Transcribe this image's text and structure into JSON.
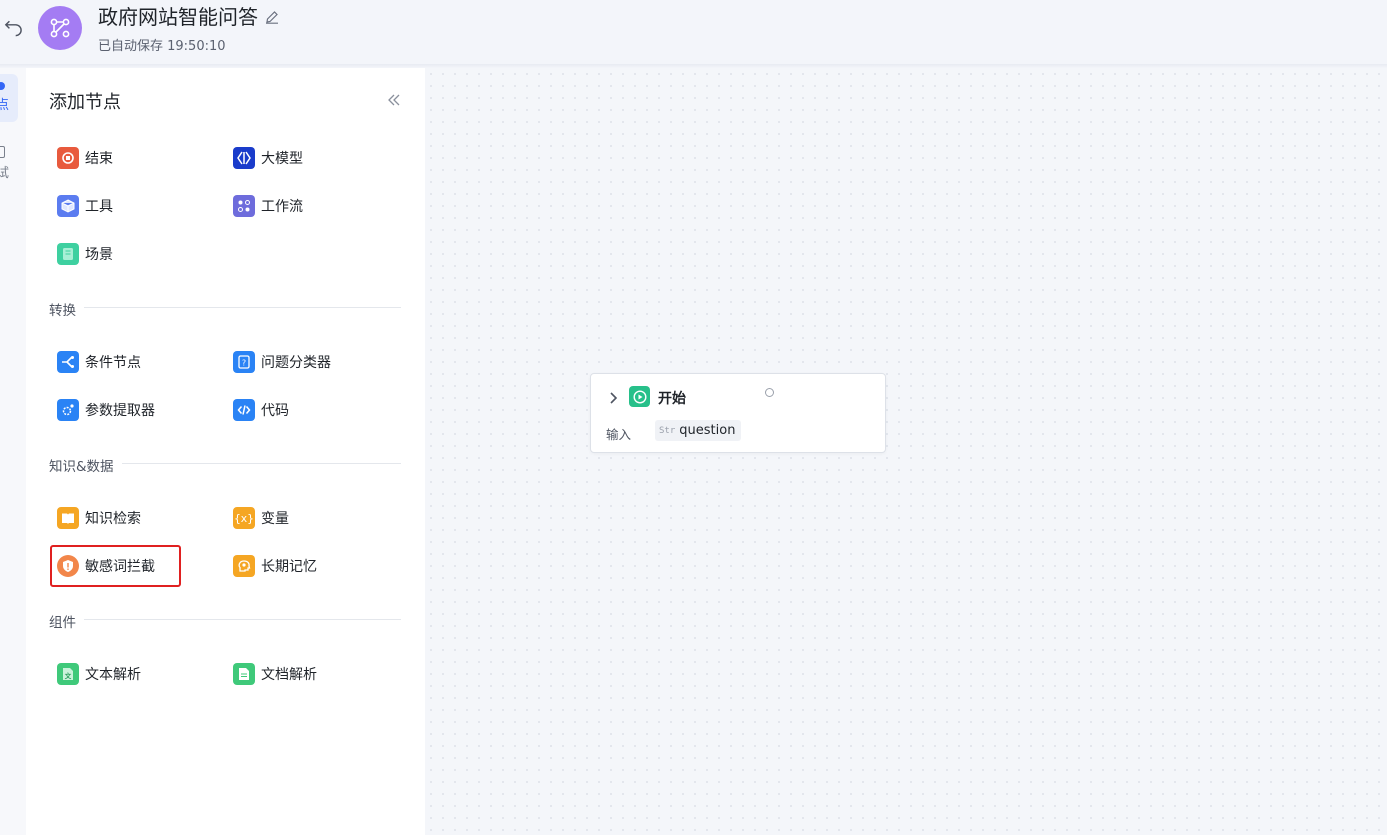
{
  "header": {
    "title": "政府网站智能问答",
    "save_status": "已自动保存 19:50:10",
    "icons": {
      "back": "undo-icon",
      "avatar": "workflow-icon",
      "edit": "pencil-icon"
    }
  },
  "rail": {
    "items": [
      {
        "label": "点",
        "active": true
      },
      {
        "label": "试",
        "active": false
      }
    ]
  },
  "panel": {
    "title": "添加节点",
    "collapse_icon": "double-chevron-left-icon",
    "general_nodes": [
      {
        "label": "结束",
        "icon": "stop-icon",
        "color": "#e85a3d"
      },
      {
        "label": "大模型",
        "icon": "llm-icon",
        "color": "#1a3ccb"
      },
      {
        "label": "工具",
        "icon": "cube-icon",
        "color": "#5b7cf0"
      },
      {
        "label": "工作流",
        "icon": "flow-icon",
        "color": "#6e6cdc"
      },
      {
        "label": "场景",
        "icon": "scene-icon",
        "color": "#3ed0a0"
      }
    ],
    "sections": [
      {
        "label": "转换",
        "nodes": [
          {
            "label": "条件节点",
            "icon": "branch-icon",
            "color": "#2a83f5"
          },
          {
            "label": "问题分类器",
            "icon": "classifier-icon",
            "color": "#2a83f5"
          },
          {
            "label": "参数提取器",
            "icon": "extract-icon",
            "color": "#2a83f5"
          },
          {
            "label": "代码",
            "icon": "code-icon",
            "color": "#2a83f5"
          }
        ]
      },
      {
        "label": "知识&数据",
        "nodes": [
          {
            "label": "知识检索",
            "icon": "book-icon",
            "color": "#f5a623"
          },
          {
            "label": "变量",
            "icon": "variable-icon",
            "color": "#f5a623"
          },
          {
            "label": "敏感词拦截",
            "icon": "shield-icon",
            "color": "#f2864a"
          },
          {
            "label": "长期记忆",
            "icon": "memory-icon",
            "color": "#f5a623"
          }
        ]
      },
      {
        "label": "组件",
        "nodes": [
          {
            "label": "文本解析",
            "icon": "text-parse-icon",
            "color": "#3fc97a"
          },
          {
            "label": "文档解析",
            "icon": "doc-parse-icon",
            "color": "#3fc97a"
          }
        ]
      }
    ]
  },
  "canvas": {
    "start_node": {
      "title": "开始",
      "icon": "play-icon",
      "input_label": "输入",
      "variable": "question",
      "variable_type_icon": "Str"
    }
  }
}
